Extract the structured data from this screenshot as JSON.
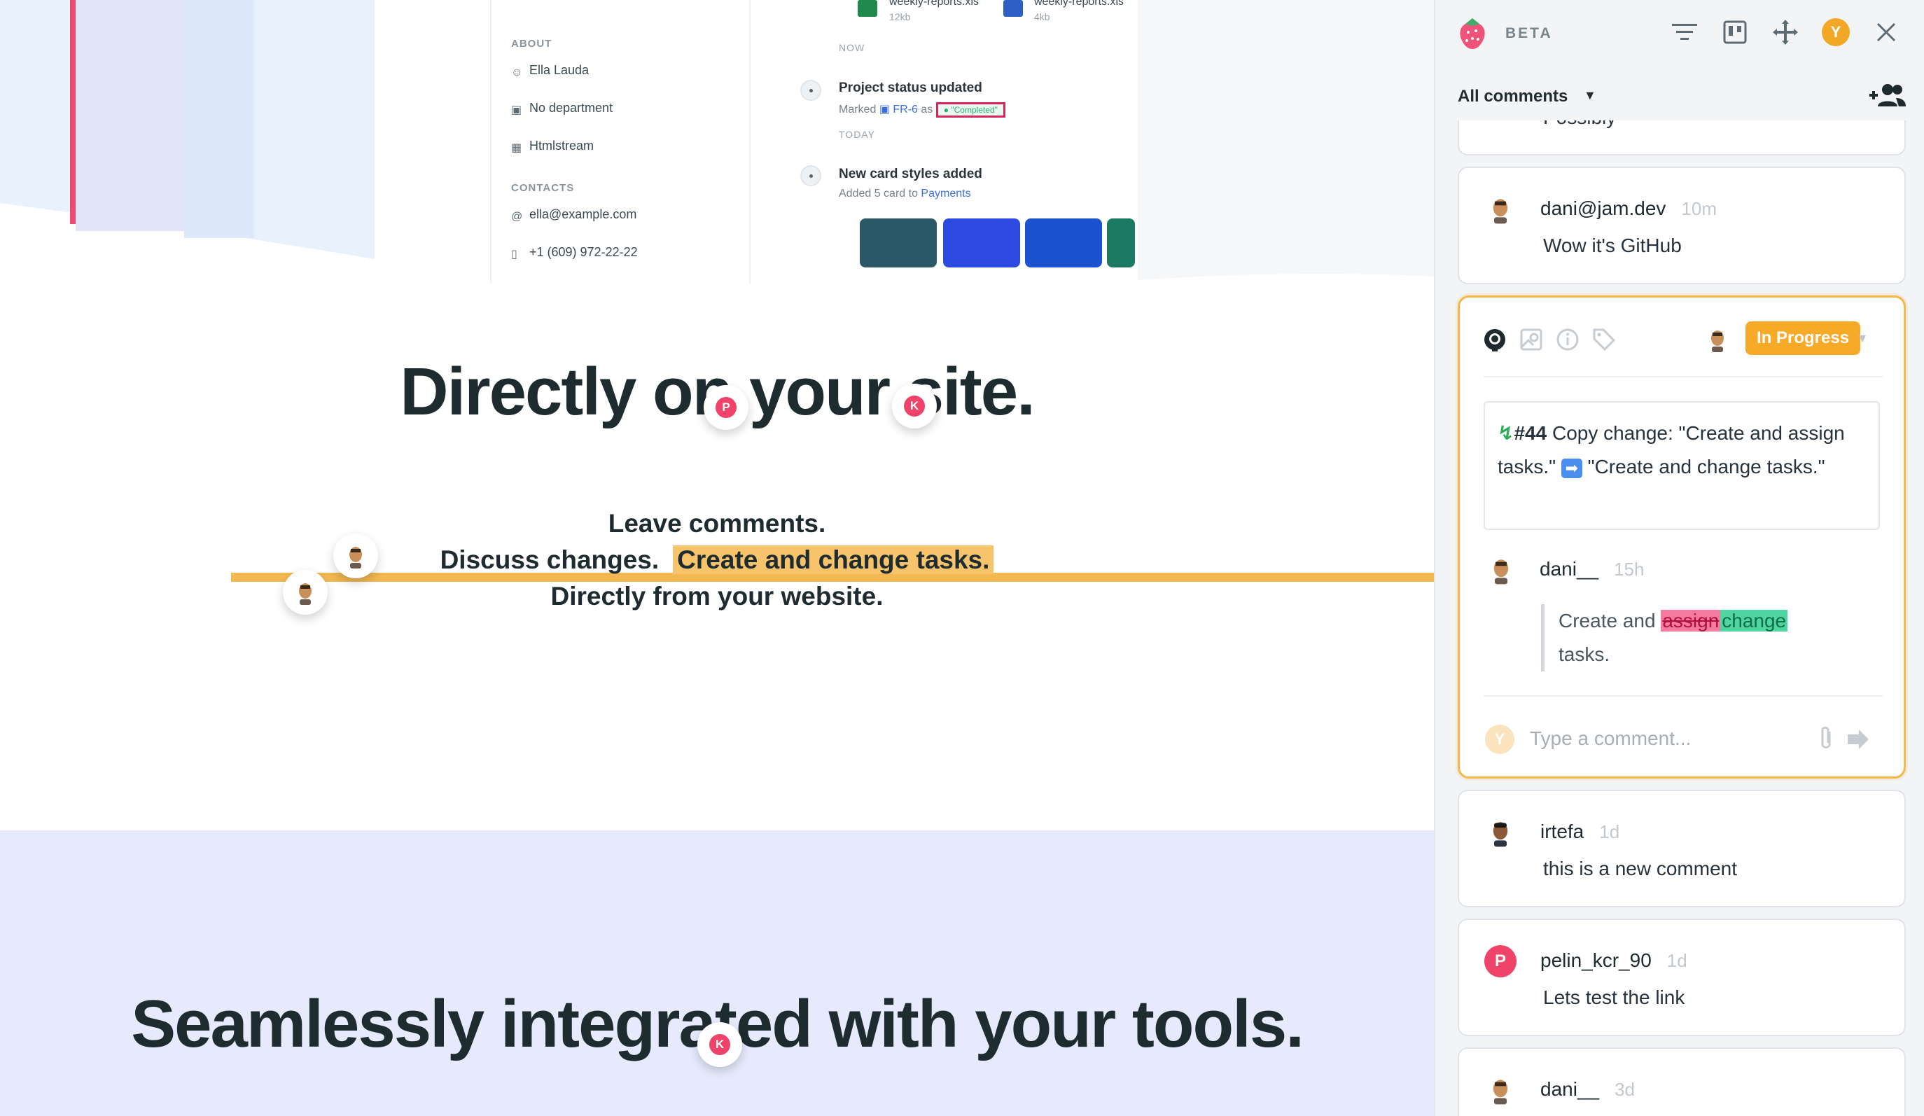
{
  "site": {
    "app_preview": {
      "about_label": "ABOUT",
      "about_items": [
        "Ella Lauda",
        "No department",
        "Htmlstream"
      ],
      "contacts_label": "CONTACTS",
      "contact_items": [
        "ella@example.com",
        "+1 (609) 972-22-22"
      ],
      "files": [
        {
          "name": "weekly-reports.xls",
          "size": "12kb"
        },
        {
          "name": "weekly-reports.xls",
          "size": "4kb"
        }
      ],
      "timeline": [
        {
          "day": "NOW",
          "title": "Project status updated",
          "sub_prefix": "Marked",
          "link": "FR-6",
          "sub_mid": "as",
          "badge": "\"Completed\""
        },
        {
          "day": "TODAY",
          "title": "New card styles added",
          "sub_prefix": "Added 5 card to",
          "link": "Payments"
        }
      ]
    },
    "headline": "Directly on your site.",
    "subline_1": "Leave comments.",
    "subline_2a": "Discuss changes.",
    "subline_2b": "Create and change tasks.",
    "subline_3": "Directly from your website.",
    "headline_2": "Seamlessly integrated with your tools.",
    "pins": [
      {
        "letter": "P",
        "color": "#ef4369"
      },
      {
        "letter": "K",
        "color": "#ef4369"
      },
      {
        "letter": "K",
        "color": "#ef4369"
      }
    ]
  },
  "panel": {
    "beta_label": "BETA",
    "filter_label": "All comments",
    "user_initial": "Y",
    "user_color": "#f2a825",
    "cards_top": {
      "partial_text": "Possibly"
    },
    "comments": [
      {
        "author": "dani@jam.dev",
        "time": "10m",
        "text": "Wow it's GitHub"
      },
      {
        "author": "irtefa",
        "time": "1d",
        "text": "this is a new comment"
      },
      {
        "author": "pelin_kcr_90",
        "time": "1d",
        "text": "Lets test the link",
        "initial": "P"
      },
      {
        "author": "dani__",
        "time": "3d",
        "text": ""
      }
    ],
    "active": {
      "status": "In Progress",
      "issue_number": "#44",
      "issue_title_1": " Copy change: \"Create and assign tasks.\"",
      "issue_title_2": " \"Create and change tasks.\"",
      "reply_author": "dani__",
      "reply_time": "15h",
      "reply_pre": "Create and ",
      "reply_deleted": "assign",
      "reply_inserted": "change",
      "reply_post": "tasks.",
      "composer_initial": "Y",
      "composer_placeholder": "Type a comment..."
    }
  }
}
